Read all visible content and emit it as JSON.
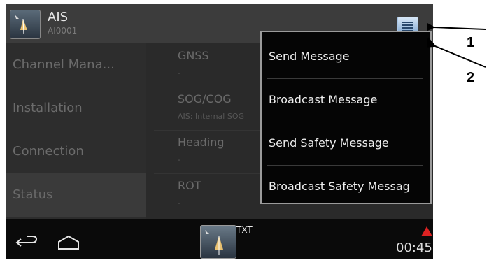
{
  "app": {
    "name": "AIS",
    "id": "AI0001"
  },
  "nav": [
    {
      "label": "Channel Mana..."
    },
    {
      "label": "Installation"
    },
    {
      "label": "Connection"
    },
    {
      "label": "Status"
    }
  ],
  "content": [
    {
      "label": "GNSS",
      "value": "-"
    },
    {
      "label": "SOG/COG",
      "value": "AIS: Internal SOG"
    },
    {
      "label": "Heading",
      "value": "-"
    },
    {
      "label": "ROT",
      "value": "-"
    }
  ],
  "popup": [
    {
      "label": "Send Message"
    },
    {
      "label": "Broadcast Message"
    },
    {
      "label": "Send Safety Message"
    },
    {
      "label": "Broadcast Safety Messag"
    }
  ],
  "bottombar": {
    "txt": "TXT",
    "time": "00:45"
  },
  "callouts": {
    "one": "1",
    "two": "2"
  }
}
